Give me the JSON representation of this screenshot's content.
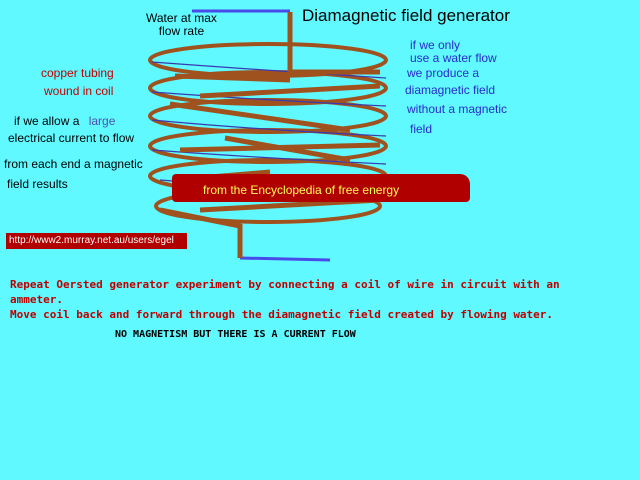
{
  "title": "Diamagnetic field generator",
  "water_label": [
    "Water at max",
    "flow rate"
  ],
  "left_labels": {
    "copper": [
      "copper tubing",
      "wound  in coil"
    ],
    "current_line1_a": "if we allow a",
    "current_line1_b": "large",
    "current_line2": "electrical current to flow",
    "current_line3": "from each end a magnetic",
    "current_line4": "field results"
  },
  "right_labels": {
    "water_flow": [
      "if  we only",
      "use a water flow"
    ],
    "produce": [
      "we produce  a",
      "diamagnetic  field",
      "without  a magnetic",
      "field"
    ]
  },
  "banner": "from  the Encyclopedia of free energy",
  "url": "http://www2.murray.net.au/users/egel",
  "body": {
    "line1": "Repeat Oersted generator experiment by connecting a coil of wire in circuit with an",
    "line2": "ammeter.",
    "line3": "Move coil back and forward through the diamagnetic field created by flowing water.",
    "line4": "NO MAGNETISM BUT THERE IS A CURRENT FLOW"
  },
  "colors": {
    "background": "#5ff9ff",
    "copper": "#a0521e",
    "banner": "#b00000",
    "pipe": "#4a4ae8"
  }
}
